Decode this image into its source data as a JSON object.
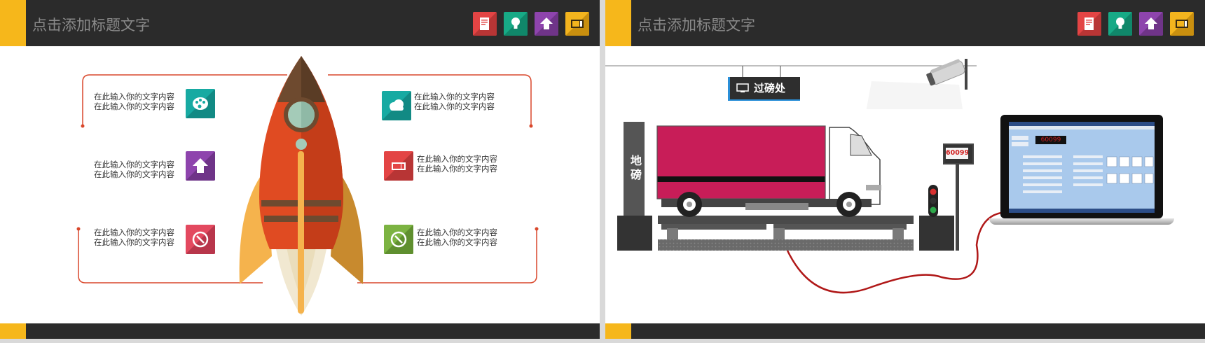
{
  "slides": [
    {
      "title": "点击添加标题文字",
      "header_icons": [
        "book-icon",
        "lightbulb-icon",
        "upload-arrow-icon",
        "ticket-icon"
      ],
      "items": [
        {
          "line1": "在此输入你的文字内容",
          "line2": "在此输入你的文字内容",
          "icon": "palette-icon",
          "color": "#17aaa2"
        },
        {
          "line1": "在此输入你的文字内容",
          "line2": "在此输入你的文字内容",
          "icon": "upload-arrow-icon",
          "color": "#8e44ad"
        },
        {
          "line1": "在此输入你的文字内容",
          "line2": "在此输入你的文字内容",
          "icon": "compass-icon",
          "color": "#e3495f"
        },
        {
          "line1": "在此输入你的文字内容",
          "line2": "在此输入你的文字内容",
          "icon": "cloud-icon",
          "color": "#17aaa2"
        },
        {
          "line1": "在此输入你的文字内容",
          "line2": "在此输入你的文字内容",
          "icon": "ticket-icon",
          "color": "#e34444"
        },
        {
          "line1": "在此输入你的文字内容",
          "line2": "在此输入你的文字内容",
          "icon": "compass-icon",
          "color": "#7cb342"
        }
      ]
    },
    {
      "title": "点击添加标题文字",
      "header_icons": [
        "book-icon",
        "lightbulb-icon",
        "upload-arrow-icon",
        "ticket-icon"
      ],
      "sign_label": "过磅处",
      "scale_label": "地磅",
      "weight_display": "60099kg",
      "laptop_reading": "60099"
    }
  ],
  "colors": {
    "accent": "#f6b71b",
    "header_bg": "#2b2b2b",
    "red": "#e34444",
    "teal": "#17aaa2",
    "purple": "#8e44ad",
    "yellow": "#f3b41e",
    "truck_box": "#c81d58"
  }
}
